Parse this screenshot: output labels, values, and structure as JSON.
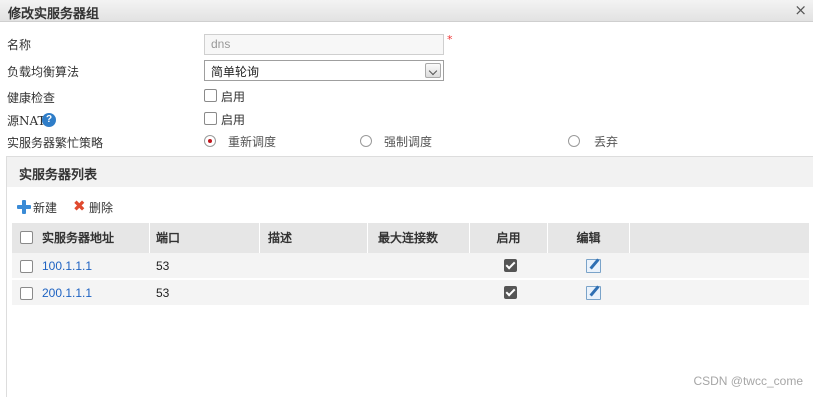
{
  "dialog": {
    "title": "修改实服务器组",
    "close_symbol": "×"
  },
  "form": {
    "name_label": "名称",
    "name_value": "dns",
    "required_mark": "*",
    "algorithm_label": "负载均衡算法",
    "algorithm_value": "简单轮询",
    "health_label": "健康检查",
    "health_option": "启用",
    "snat_label": "源NAT",
    "snat_help": "?",
    "snat_option": "启用",
    "busy_label": "实服务器繁忙策略",
    "busy_options": [
      "重新调度",
      "强制调度",
      "丢弃"
    ],
    "busy_selected": "重新调度"
  },
  "panel": {
    "title": "实服务器列表",
    "new_button": "新建",
    "delete_button": "删除",
    "columns": [
      "实服务器地址",
      "端口",
      "描述",
      "最大连接数",
      "启用",
      "编辑"
    ],
    "rows": [
      {
        "address": "100.1.1.1",
        "port": "53",
        "description": "",
        "max_conn": "",
        "enabled": true
      },
      {
        "address": "200.1.1.1",
        "port": "53",
        "description": "",
        "max_conn": "",
        "enabled": true
      }
    ]
  },
  "watermark": "CSDN @twcc_come",
  "colors": {
    "link": "#1d62c2",
    "radio_selected": "#c0161c",
    "required": "#e33333",
    "add_icon": "#3a8bd6",
    "delete_icon": "#e04a2f"
  }
}
